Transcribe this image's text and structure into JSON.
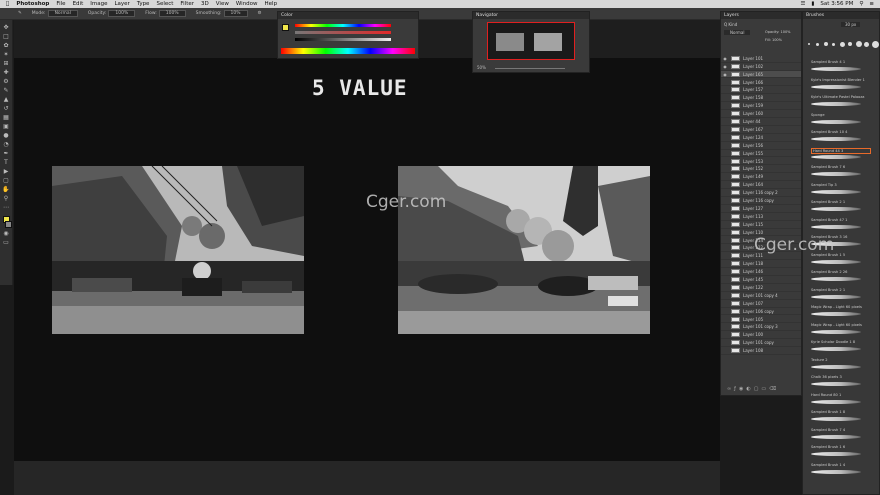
{
  "menubar": {
    "app": "Photoshop",
    "items": [
      "File",
      "Edit",
      "Image",
      "Layer",
      "Type",
      "Select",
      "Filter",
      "3D",
      "View",
      "Window",
      "Help"
    ],
    "clock": "Sat 3:56 PM"
  },
  "options": {
    "mode_label": "Mode:",
    "mode_value": "Normal",
    "opacity_label": "Opacity:",
    "opacity_value": "100%",
    "flow_label": "Flow:",
    "flow_value": "100%",
    "smoothing_label": "Smoothing:",
    "smoothing_value": "10%"
  },
  "canvas": {
    "title_text": "5 VALUE"
  },
  "watermark": {
    "text": "Cger.com"
  },
  "panels": {
    "color_title": "Color",
    "navigator_title": "Navigator",
    "navigator_zoom": "50%",
    "layers_title": "Layers",
    "brushes_title": "Brushes",
    "layers_kind": "Q Kind",
    "layers_mode": "Normal",
    "layers_opacity": "Opacity: 100%",
    "layers_fill": "Fill: 100%",
    "brushes_size": "30 px"
  },
  "layers": [
    "Layer 101",
    "Layer 102",
    "Layer 165",
    "Layer 166",
    "Layer 157",
    "Layer 158",
    "Layer 159",
    "Layer 160",
    "Layer 44",
    "Layer 167",
    "Layer 124",
    "Layer 156",
    "Layer 155",
    "Layer 153",
    "Layer 152",
    "Layer 149",
    "Layer 164",
    "Layer 116 copy 2",
    "Layer 116 copy",
    "Layer 127",
    "Layer 113",
    "Layer 115",
    "Layer 110",
    "Layer 114",
    "Layer 112",
    "Layer 111",
    "Layer 118",
    "Layer 146",
    "Layer 145",
    "Layer 122",
    "Layer 101 copy 4",
    "Layer 107",
    "Layer 106 copy",
    "Layer 105",
    "Layer 101 copy 3",
    "Layer 100",
    "Layer 101 copy",
    "Layer 108"
  ],
  "brushes": [
    "Sampled Brush 4 1",
    "Kyle's Impressionist Blender 1",
    "Kyle's Ultimate Pastel Palooza",
    "Sponge",
    "Sampled Brush 10 4",
    "Hard Round 44 3",
    "Sampled Brush 7 6",
    "Sampled Tip 3",
    "Sampled Brush 2 1",
    "Sampled Brush 47 1",
    "Sampled Brush 3 16",
    "Sampled Brush 1 5",
    "Sampled Brush 2 26",
    "Sampled Brush 2 1",
    "Magic Wrap - Light 60 pixels",
    "Magic Wrap - Light 60 pixels",
    "Kyrie Scholar Doodle 1 8",
    "Texture 2",
    "Chalk 36 pixels 3",
    "Hard Round 80 1",
    "Sampled Brush 1 8",
    "Sampled Brush 7 4",
    "Sampled Brush 1 6",
    "Sampled Brush 1 4"
  ],
  "colors": {
    "fg": "#f0e64a",
    "accent_selection": "#e86a2a",
    "navigator_frame": "#e02020"
  }
}
